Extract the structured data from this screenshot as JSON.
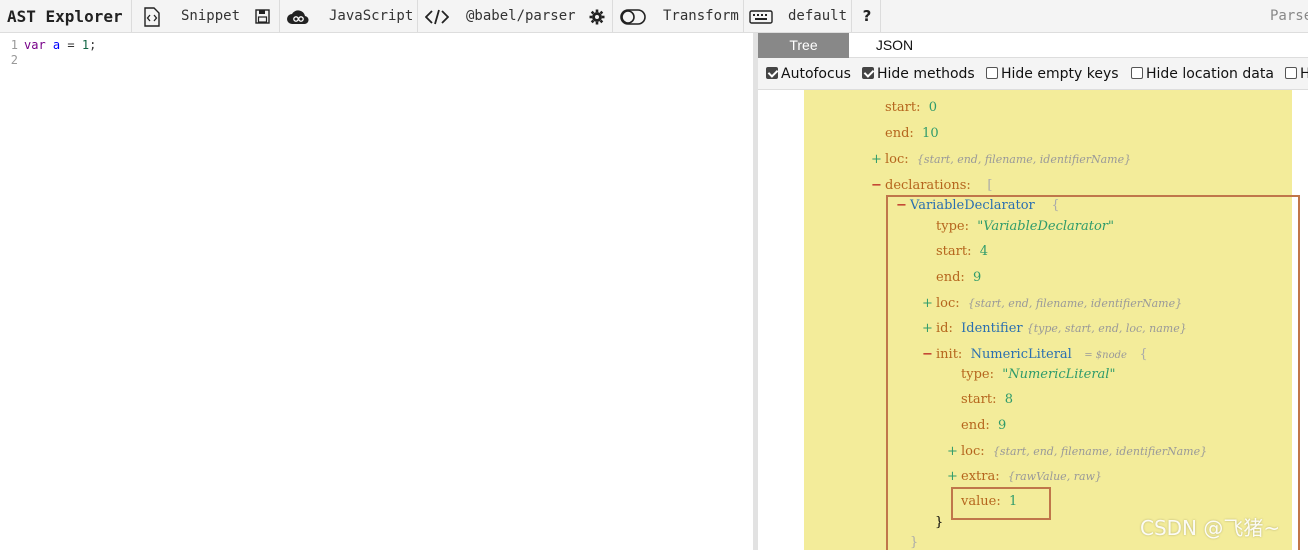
{
  "toolbar": {
    "brand": "AST Explorer",
    "snippet": "Snippet",
    "language": "JavaScript",
    "parser": "@babel/parser",
    "transform": "Transform",
    "keymap": "default",
    "help": "?",
    "parse_status": "Parse"
  },
  "editor": {
    "lines": [
      {
        "num": "1",
        "kw": "var",
        "ident": "a",
        "op": "=",
        "value": "1",
        "end": ";"
      },
      {
        "num": "2"
      }
    ]
  },
  "output": {
    "tabs": {
      "tree": "Tree",
      "json": "JSON"
    },
    "options": {
      "autofocus": "Autofocus",
      "hide_methods": "Hide methods",
      "hide_empty_keys": "Hide empty keys",
      "hide_location": "Hide location data",
      "hide_more": "H"
    },
    "tree": {
      "start_key": "start:",
      "start_val": "0",
      "end_key": "end:",
      "end_val": "10",
      "loc_key": "loc:",
      "loc_summary": "{start, end, filename, identifierName}",
      "decl_key": "declarations:",
      "decl_open": "[",
      "vd_name": "VariableDeclarator",
      "vd_open": "{",
      "vd_type_key": "type:",
      "vd_type_val": "\"VariableDeclarator\"",
      "vd_start_key": "start:",
      "vd_start_val": "4",
      "vd_end_key": "end:",
      "vd_end_val": "9",
      "vd_loc_key": "loc:",
      "vd_loc_summary": "{start, end, filename, identifierName}",
      "id_key": "id:",
      "id_name": "Identifier",
      "id_summary": "{type, start, end, loc, name}",
      "init_key": "init:",
      "init_name": "NumericLiteral",
      "init_hint": "= $node",
      "init_open": "{",
      "nl_type_key": "type:",
      "nl_type_val": "\"NumericLiteral\"",
      "nl_start_key": "start:",
      "nl_start_val": "8",
      "nl_end_key": "end:",
      "nl_end_val": "9",
      "nl_loc_key": "loc:",
      "nl_loc_summary": "{start, end, filename, identifierName}",
      "extra_key": "extra:",
      "extra_summary": "{rawValue, raw}",
      "value_key": "value:",
      "value_val": "1",
      "close_inner": "}",
      "close_outer": "}"
    },
    "plus": "+",
    "minus": "−"
  },
  "watermark": "CSDN @飞猪~"
}
